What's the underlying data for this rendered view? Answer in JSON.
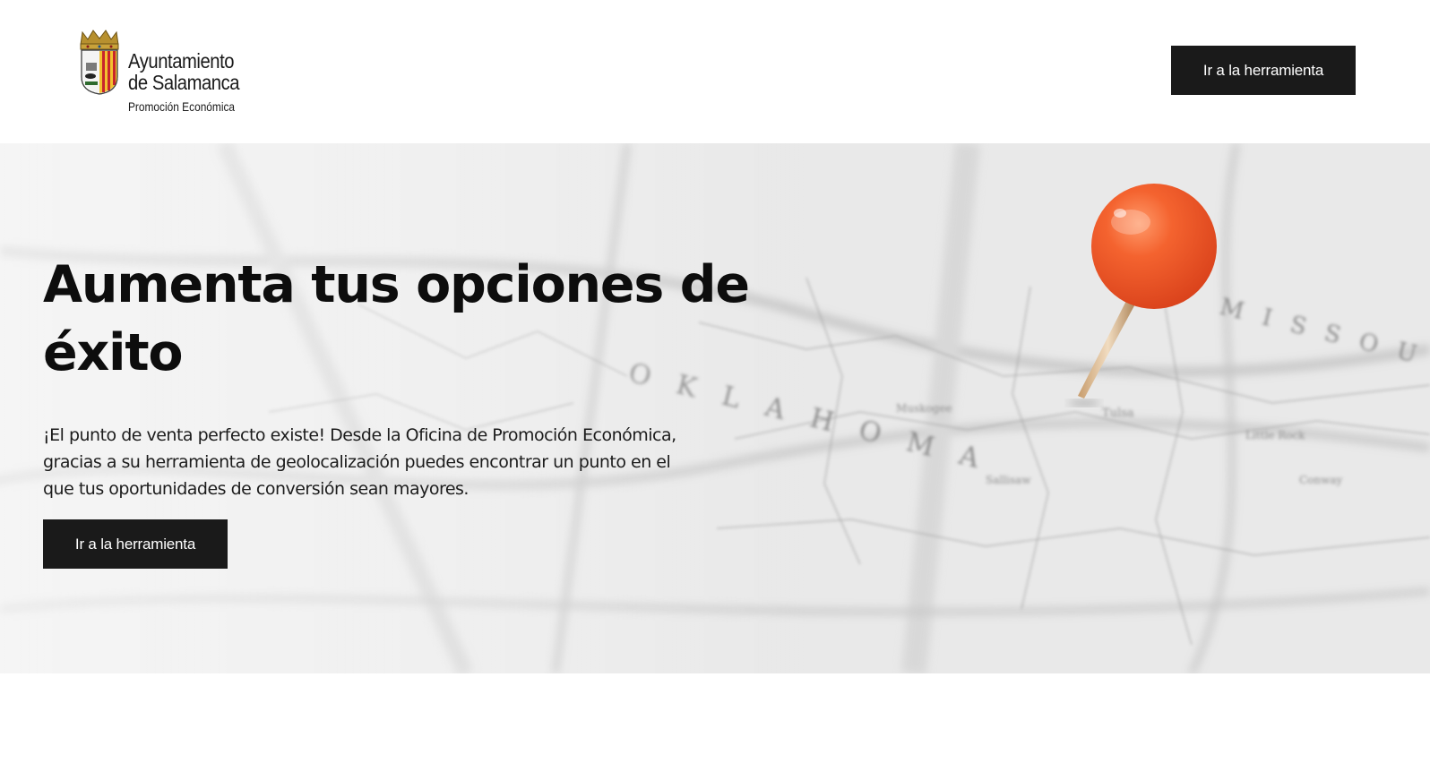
{
  "header": {
    "logo": {
      "line1": "Ayuntamiento",
      "line2": "de Salamanca",
      "line3": "Promoción Económica"
    },
    "cta_label": "Ir a la herramienta"
  },
  "hero": {
    "title": "Aumenta tus opciones de éxito",
    "text": "¡El punto de venta perfecto existe! Desde la Oficina de Promoción Económica, gracias a su herramienta de geolocalización puedes encontrar un punto en el que tus oportunidades de conversión sean mayores.",
    "cta_label": "Ir a la herramienta",
    "image_icon": "map-with-pushpin",
    "map_labels": [
      "OKLAHOMA",
      "MISSOURI",
      "Tulsa",
      "Muskogee",
      "Little Rock"
    ]
  },
  "colors": {
    "button_bg": "#1a1a1a",
    "button_text": "#ffffff",
    "pin": "#f05a2a",
    "title": "#0d0d0d"
  }
}
